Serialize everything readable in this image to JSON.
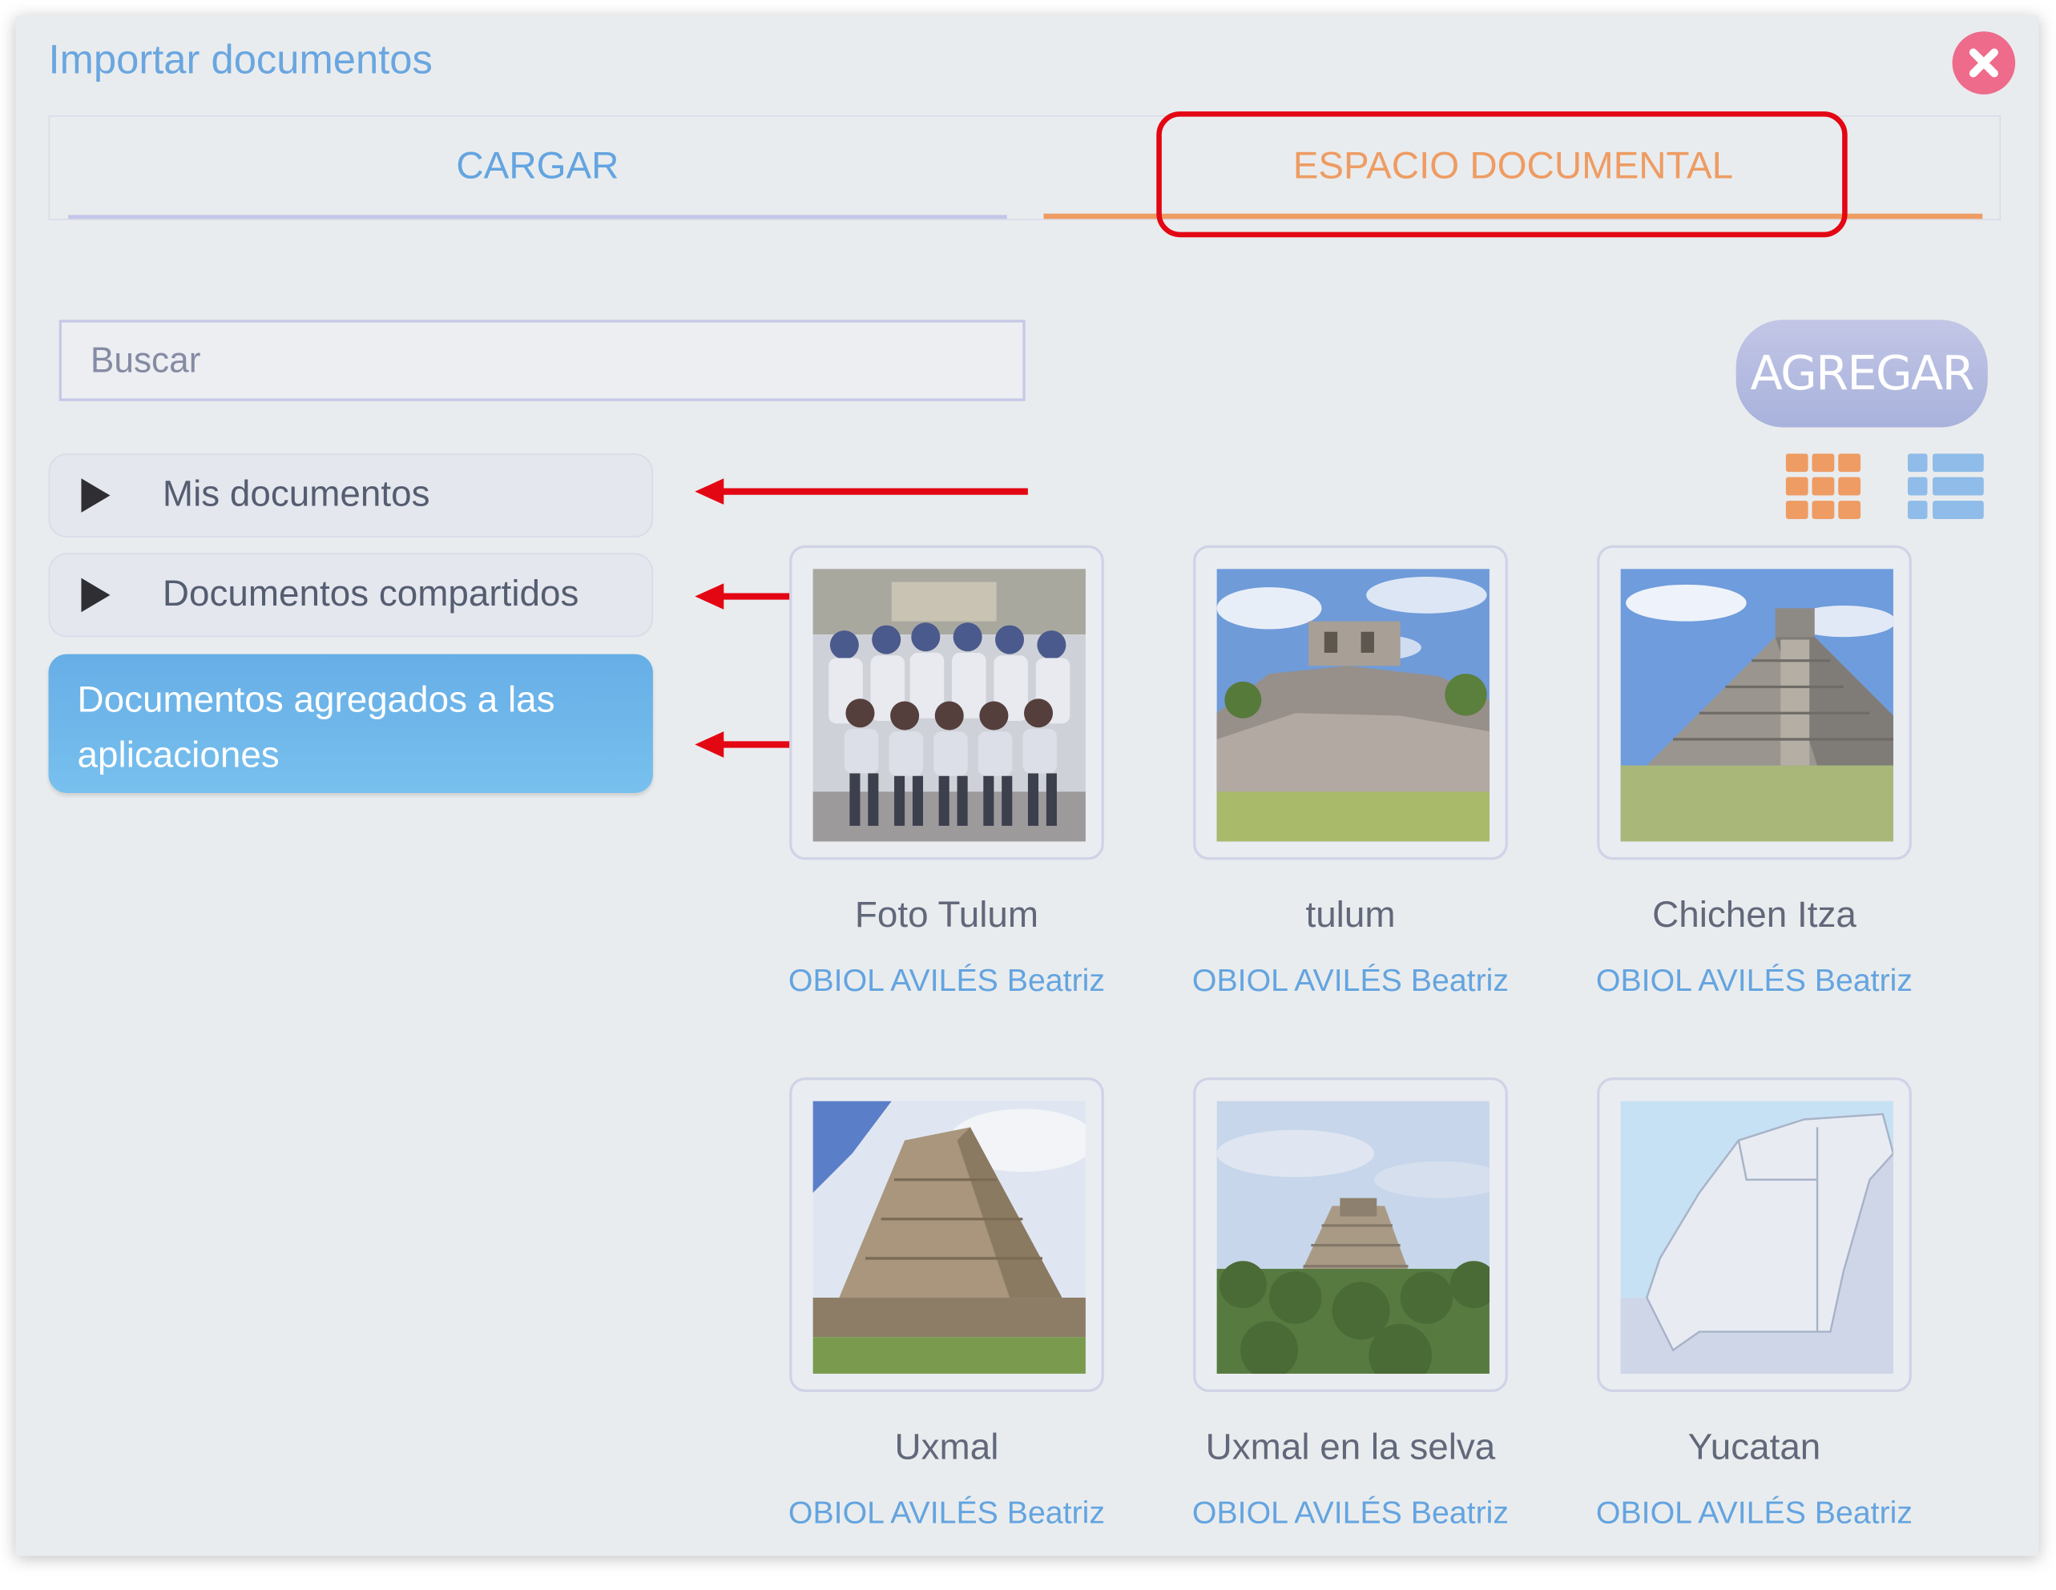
{
  "dialog": {
    "title": "Importar documentos",
    "close_icon": "close-icon"
  },
  "tabs": [
    {
      "label": "CARGAR",
      "active": false
    },
    {
      "label": "ESPACIO DOCUMENTAL",
      "active": true
    }
  ],
  "search": {
    "placeholder": "Buscar",
    "value": ""
  },
  "add_button": {
    "label": "AGREGAR"
  },
  "view_toggle": {
    "grid_icon": "grid-view-icon",
    "list_icon": "list-view-icon",
    "selected": "grid"
  },
  "sidebar": {
    "items": [
      {
        "label": "Mis documentos",
        "icon": "expand-triangle-icon"
      },
      {
        "label": "Documentos compartidos",
        "icon": "expand-triangle-icon"
      },
      {
        "label": "Documentos agregados a las aplicaciones",
        "active": true
      }
    ]
  },
  "documents": [
    {
      "name": "Foto Tulum",
      "owner": "OBIOL AVILÉS Beatriz",
      "thumbnail": "group-photo"
    },
    {
      "name": "tulum",
      "owner": "OBIOL AVILÉS Beatriz",
      "thumbnail": "ruins-photo"
    },
    {
      "name": "Chichen Itza",
      "owner": "OBIOL AVILÉS Beatriz",
      "thumbnail": "pyramid-photo"
    },
    {
      "name": "Uxmal",
      "owner": "OBIOL AVILÉS Beatriz",
      "thumbnail": "pyramid-photo"
    },
    {
      "name": "Uxmal en la selva",
      "owner": "OBIOL AVILÉS Beatriz",
      "thumbnail": "jungle-pyramid-photo"
    },
    {
      "name": "Yucatan",
      "owner": "OBIOL AVILÉS Beatriz",
      "thumbnail": "map-image"
    }
  ],
  "colors": {
    "accent_blue": "#64a4e0",
    "accent_orange": "#ee9c63",
    "annotation_red": "#e30613",
    "close_pink": "#ee6b8b"
  }
}
